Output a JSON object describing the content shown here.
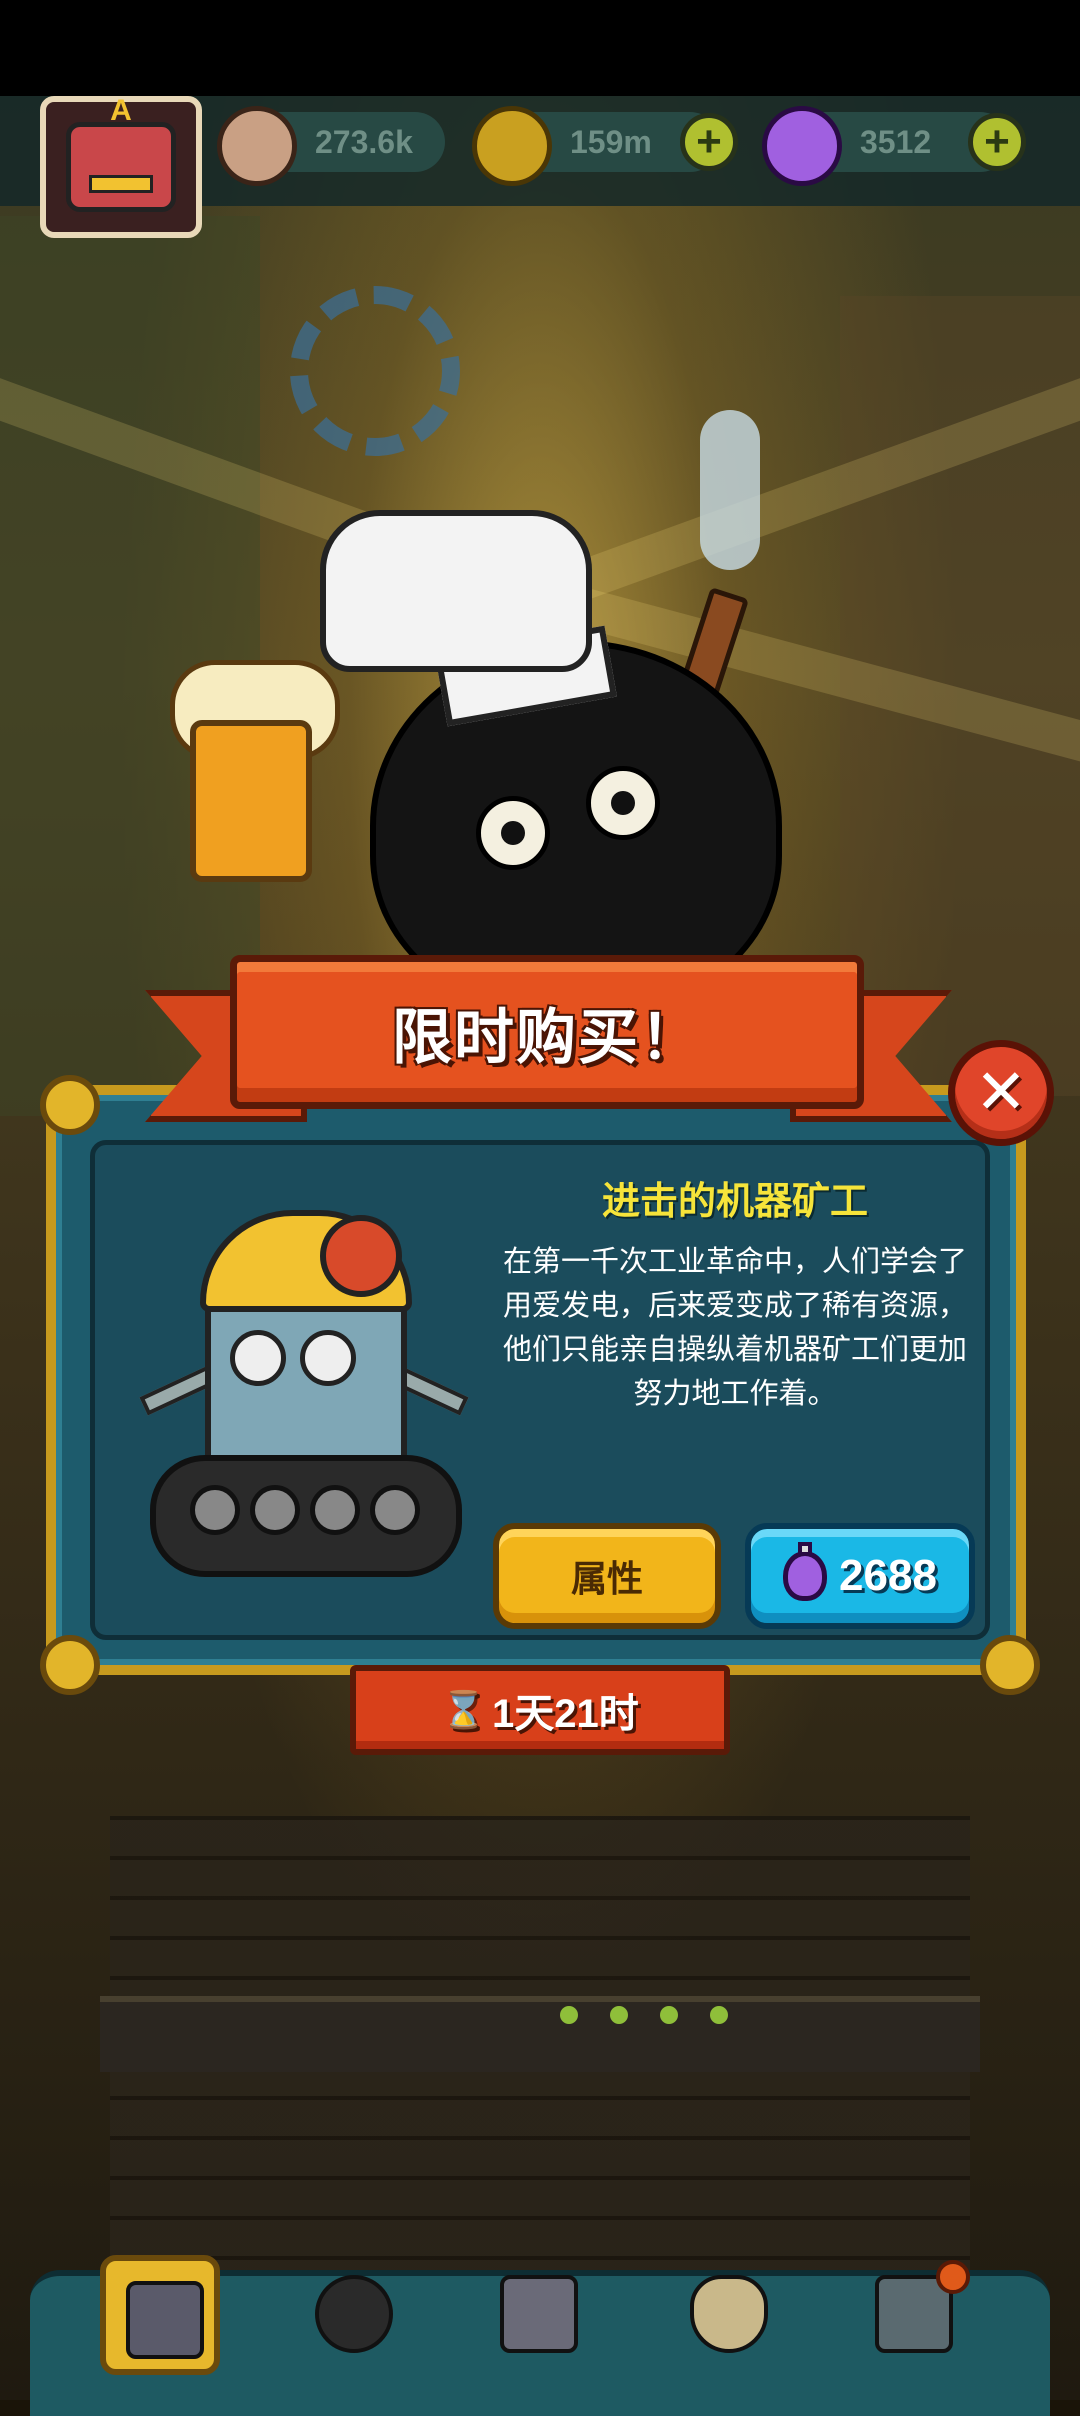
{
  "topbar": {
    "resources": [
      {
        "icon": "eyeball-icon",
        "value": "273.6k"
      },
      {
        "icon": "gold-coin-icon",
        "value": "159m"
      },
      {
        "icon": "potion-icon",
        "value": "3512"
      }
    ],
    "plus_symbol": "+"
  },
  "popup": {
    "title": "限时购买！",
    "close_symbol": "✕",
    "item": {
      "name": "进击的机器矿工",
      "description": "在第一千次工业革命中，人们学会了用爱发电，后来爱变成了稀有资源，他们只能亲自操纵着机器矿工们更加努力地工作着。"
    },
    "attributes_button": "属性",
    "buy_button": {
      "currency_icon": "potion-icon",
      "price": "2688"
    },
    "timer": {
      "icon": "hourglass-icon",
      "text": "1天21时"
    }
  },
  "bottom_nav": {
    "items": [
      {
        "icon": "building-icon",
        "active": true
      },
      {
        "icon": "monster-icon",
        "active": false
      },
      {
        "icon": "book-icon",
        "active": false
      },
      {
        "icon": "money-bag-icon",
        "active": false
      },
      {
        "icon": "grid-menu-icon",
        "active": false
      }
    ]
  },
  "colors": {
    "panel": "#1d5b6c",
    "ribbon": "#e5521f",
    "gold_trim": "#c79a1e",
    "attr_button": "#f2b51a",
    "buy_button": "#1ab8e6",
    "item_name": "#f6e43a"
  }
}
